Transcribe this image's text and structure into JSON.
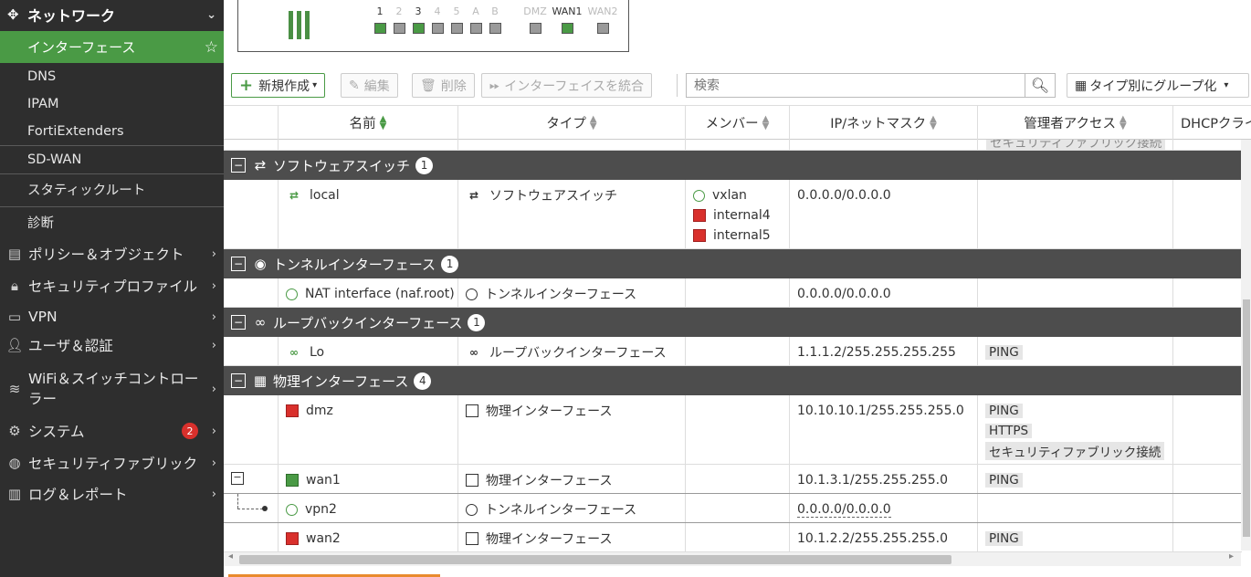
{
  "sidebar": {
    "header": "ネットワーク",
    "active": "インターフェース",
    "subitems": [
      "DNS",
      "IPAM",
      "FortiExtenders",
      "SD-WAN",
      "スタティックルート",
      "診断"
    ],
    "items": [
      {
        "label": "ポリシー＆オブジェクト",
        "icon": "policy-icon"
      },
      {
        "label": "セキュリティプロファイル",
        "icon": "lock-icon"
      },
      {
        "label": "VPN",
        "icon": "laptop-icon"
      },
      {
        "label": "ユーザ＆認証",
        "icon": "user-icon"
      },
      {
        "label": "WiFi＆スイッチコントローラー",
        "icon": "wifi-icon"
      },
      {
        "label": "システム",
        "icon": "gear-icon",
        "badge": "2"
      },
      {
        "label": "セキュリティファブリック",
        "icon": "fabric-icon"
      },
      {
        "label": "ログ＆レポート",
        "icon": "chart-icon"
      }
    ]
  },
  "ports": {
    "labels": [
      "1",
      "2",
      "3",
      "4",
      "5",
      "A",
      "B",
      "DMZ",
      "WAN1",
      "WAN2"
    ]
  },
  "toolbar": {
    "create": "新規作成",
    "edit": "編集",
    "delete": "削除",
    "integrate": "インターフェイスを統合",
    "search_placeholder": "検索",
    "group_by": "タイプ別にグループ化"
  },
  "table": {
    "headers": {
      "name": "名前",
      "type": "タイプ",
      "members": "メンバー",
      "ip": "IP/ネットマスク",
      "admin": "管理者アクセス",
      "dhcp": "DHCPクライ"
    },
    "clipped_top": "セキュリティファブリック接続",
    "groups": {
      "software_switch": {
        "label": "ソフトウェアスイッチ",
        "count": "1"
      },
      "tunnel": {
        "label": "トンネルインターフェース",
        "count": "1"
      },
      "loopback": {
        "label": "ループバックインターフェース",
        "count": "1"
      },
      "physical": {
        "label": "物理インターフェース",
        "count": "4"
      }
    },
    "rows": {
      "local": {
        "name": "local",
        "type": "ソフトウェアスイッチ",
        "members": [
          "vxlan",
          "internal4",
          "internal5"
        ],
        "ip": "0.0.0.0/0.0.0.0"
      },
      "nat": {
        "name": "NAT interface (naf.root)",
        "type": "トンネルインターフェース",
        "ip": "0.0.0.0/0.0.0.0"
      },
      "lo": {
        "name": "Lo",
        "type": "ループバックインターフェース",
        "ip": "1.1.1.2/255.255.255.255",
        "access": [
          "PING"
        ]
      },
      "dmz": {
        "name": "dmz",
        "type": "物理インターフェース",
        "ip": "10.10.10.1/255.255.255.0",
        "access": [
          "PING",
          "HTTPS",
          "セキュリティファブリック接続"
        ]
      },
      "wan1": {
        "name": "wan1",
        "type": "物理インターフェース",
        "ip": "10.1.3.1/255.255.255.0",
        "access": [
          "PING"
        ]
      },
      "vpn2": {
        "name": "vpn2",
        "type": "トンネルインターフェース",
        "ip": "0.0.0.0/0.0.0.0"
      },
      "wan2": {
        "name": "wan2",
        "type": "物理インターフェース",
        "ip": "10.1.2.2/255.255.255.0",
        "access": [
          "PING"
        ]
      }
    }
  }
}
